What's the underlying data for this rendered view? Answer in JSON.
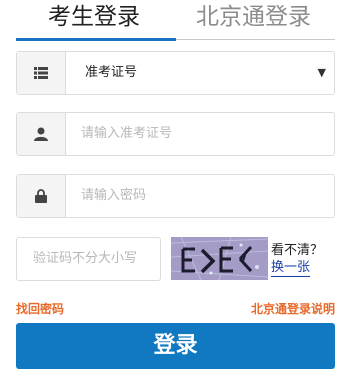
{
  "tabs": [
    {
      "label": "考生登录",
      "active": true
    },
    {
      "label": "北京通登录",
      "active": false
    }
  ],
  "id_type_select": {
    "value": "准考证号"
  },
  "exam_number_input": {
    "placeholder": "请输入准考证号"
  },
  "password_input": {
    "placeholder": "请输入密码"
  },
  "captcha_input": {
    "placeholder": "验证码不分大小写"
  },
  "captcha_help": {
    "cant_see": "看不清？",
    "refresh": "换一张"
  },
  "links": {
    "forgot_password": "找回密码",
    "bjt_help": "北京通登录说明"
  },
  "login_button": {
    "label": "登录"
  },
  "colors": {
    "accent": "#1079c2",
    "link": "#e86a2b"
  }
}
